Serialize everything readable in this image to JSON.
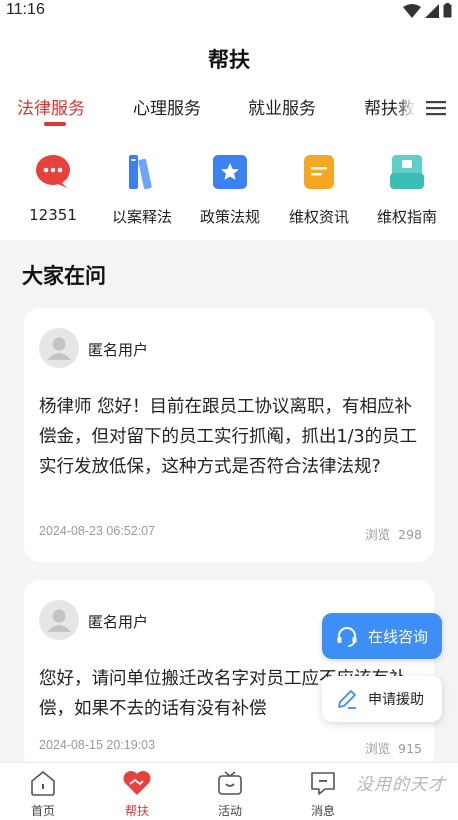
{
  "status_bar": {
    "time": "11:16"
  },
  "header": {
    "title": "帮扶"
  },
  "tabs": [
    {
      "label": "法律服务",
      "active": true
    },
    {
      "label": "心理服务",
      "active": false
    },
    {
      "label": "就业服务",
      "active": false
    },
    {
      "label": "帮扶救",
      "active": false
    }
  ],
  "services": [
    {
      "label": "12351",
      "icon": "chat-bubble-icon",
      "color": "#e8413b"
    },
    {
      "label": "以案释法",
      "icon": "books-icon",
      "color": "#3b82f0"
    },
    {
      "label": "政策法规",
      "icon": "star-doc-icon",
      "color": "#3b82f0"
    },
    {
      "label": "维权资讯",
      "icon": "news-icon",
      "color": "#f5a623"
    },
    {
      "label": "维权指南",
      "icon": "guide-icon",
      "color": "#3bbfb5"
    }
  ],
  "section": {
    "title": "大家在问"
  },
  "questions": [
    {
      "user": "匿名用户",
      "text": "杨律师 您好！目前在跟员工协议离职，有相应补偿金，但对留下的员工实行抓阄，抓出1/3的员工实行发放低保，这种方式是否符合法律法规?",
      "date": "2024-08-23 06:52:07",
      "views_label": "浏览",
      "views": "298"
    },
    {
      "user": "匿名用户",
      "text": "您好，请问单位搬迁改名字对员工应不应该有补偿，如果不去的话有没有补偿",
      "date": "2024-08-15 20:19:03",
      "views_label": "浏览",
      "views": "915"
    }
  ],
  "fab": {
    "consult": "在线咨询",
    "aid": "申请援助"
  },
  "bottom_nav": [
    {
      "label": "首页",
      "icon": "home-icon",
      "active": false
    },
    {
      "label": "帮扶",
      "icon": "handshake-icon",
      "active": true
    },
    {
      "label": "活动",
      "icon": "activity-icon",
      "active": false
    },
    {
      "label": "消息",
      "icon": "message-icon",
      "active": false
    }
  ],
  "watermark": "没用的天才",
  "colors": {
    "accent": "#e0342f",
    "primary_blue": "#3d8ff5"
  }
}
